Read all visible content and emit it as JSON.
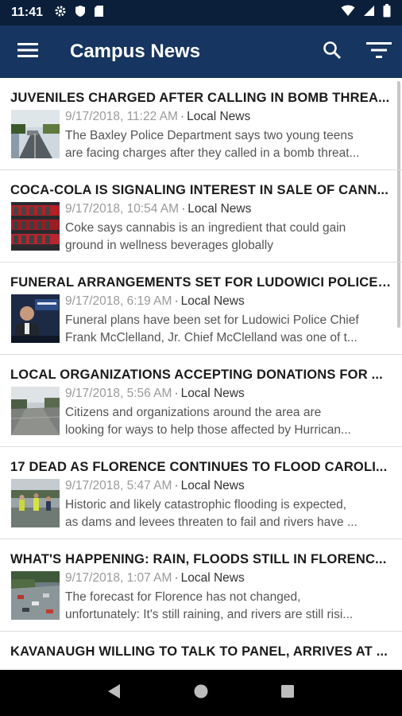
{
  "status": {
    "time": "11:41"
  },
  "app": {
    "title": "Campus News"
  },
  "articles": [
    {
      "title": "JUVENILES CHARGED AFTER CALLING IN BOMB THREA...",
      "date": "9/17/2018, 11:22 AM",
      "source": "Local News",
      "summary_line1": "The Baxley Police Department says two young teens",
      "summary_line2": "are facing charges after they called in a bomb threat..."
    },
    {
      "title": "COCA-COLA IS SIGNALING INTEREST IN SALE OF CANN...",
      "date": "9/17/2018, 10:54 AM",
      "source": "Local News",
      "summary_line1": "Coke says cannabis is an ingredient that could gain",
      "summary_line2": "ground in wellness beverages globally"
    },
    {
      "title": "FUNERAL ARRANGEMENTS SET FOR LUDOWICI POLICE ...",
      "date": "9/17/2018, 6:19 AM",
      "source": "Local News",
      "summary_line1": "Funeral plans have been set for Ludowici Police Chief",
      "summary_line2": "Frank McClelland, Jr. Chief McClelland was one of t..."
    },
    {
      "title": "LOCAL ORGANIZATIONS ACCEPTING DONATIONS FOR ...",
      "date": "9/17/2018, 5:56 AM",
      "source": "Local News",
      "summary_line1": "Citizens and organizations around the area are",
      "summary_line2": "looking for ways to help those affected by Hurrican..."
    },
    {
      "title": "17 DEAD AS FLORENCE CONTINUES TO FLOOD CAROLI...",
      "date": "9/17/2018, 5:47 AM",
      "source": "Local News",
      "summary_line1": "Historic and likely catastrophic flooding is expected,",
      "summary_line2": "as dams and levees threaten to fail and rivers have ..."
    },
    {
      "title": "WHAT'S HAPPENING: RAIN, FLOODS STILL IN FLORENC...",
      "date": "9/17/2018, 1:07 AM",
      "source": "Local News",
      "summary_line1": "The forecast for Florence has not changed,",
      "summary_line2": "unfortunately: It's still raining, and rivers are still risi..."
    },
    {
      "title": "KAVANAUGH WILLING TO TALK TO PANEL, ARRIVES AT ...",
      "date": "",
      "source": "",
      "summary_line1": "",
      "summary_line2": ""
    }
  ],
  "colors": {
    "status_bar": "#0b1f3a",
    "app_bar": "#163560",
    "nav_bar": "#000000"
  },
  "icons": {
    "menu": "hamburger-menu-icon",
    "search": "search-icon",
    "filter": "filter-icon",
    "back": "back-triangle-icon",
    "home": "home-circle-icon",
    "recents": "recents-square-icon"
  }
}
